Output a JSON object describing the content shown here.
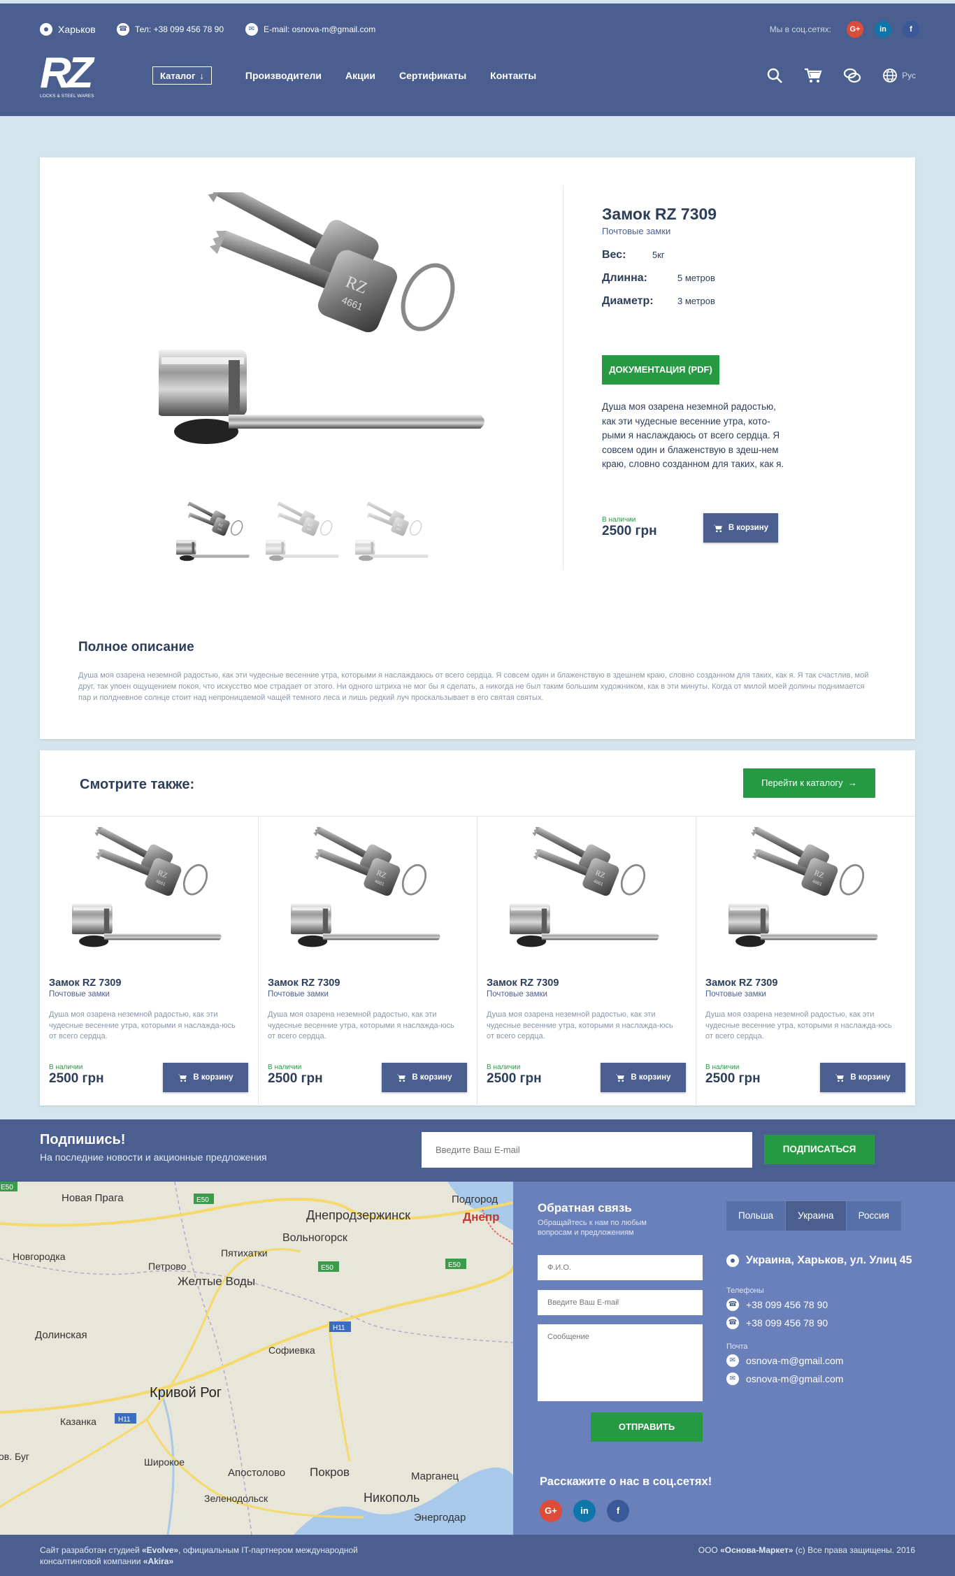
{
  "header": {
    "city": "Харьков",
    "phone": "Тел: +38 099 456 78 90",
    "email": "E-mail: osnova-m@gmail.com",
    "social_label": "Мы в соц.сетях:",
    "social": [
      {
        "icon": "google-plus-icon",
        "label": "G+",
        "color": "#dd4b39"
      },
      {
        "icon": "linkedin-icon",
        "label": "in",
        "color": "#0e76a8"
      },
      {
        "icon": "facebook-icon",
        "label": "f",
        "color": "#3b5998"
      }
    ],
    "logo_text": "RZ",
    "logo_sub": "LOCKS & STEEL WARES",
    "catalog": "Каталог",
    "nav": [
      "Производители",
      "Акции",
      "Сертификаты",
      "Контакты"
    ],
    "lang": "Рус"
  },
  "product": {
    "title": "Замок RZ 7309",
    "category": "Почтовые замки",
    "specs": [
      {
        "key": "Вес:",
        "value": "5кг"
      },
      {
        "key": "Длинна:",
        "value": "5 метров"
      },
      {
        "key": "Диаметр:",
        "value": "3 метров"
      }
    ],
    "doc_button": "ДОКУМЕНТАЦИЯ (PDF)",
    "description": "Душа моя озарена неземной радостью, как эти чудесные весенние утра, кото-рыми я наслаждаюсь от всего сердца. Я совсем один и блаженствую в здеш-нем краю, словно созданном для таких, как я.",
    "stock": "В наличии",
    "price": "2500 грн",
    "cart_button": "В корзину",
    "full_title": "Полное описание",
    "full_text": "Душа моя озарена неземной радостью, как эти чудесные весенние утра, которыми я наслаждаюсь от всего сердца. Я совсем один и блаженствую в здешнем краю, словно созданном для таких, как я. Я так счастлив, мой друг, так упоен ощущением покоя, что искусство мое страдает от этого. Ни одного штриха не мог бы я сделать, а никогда не был таким большим художником, как в эти минуты. Когда от милой моей долины поднимается пар и полдневное солнце стоит над непроницаемой чащей темного леса и лишь редкий луч проскальзывает в его святая святых."
  },
  "see_also": {
    "title": "Смотрите также:",
    "catalog_button": "Перейти к каталогу",
    "items": [
      {
        "name": "Замок RZ 7309",
        "category": "Почтовые замки",
        "desc": "Душа моя озарена неземной радостью, как эти чудесные весенние утра, которыми я наслажда-юсь от всего сердца.",
        "stock": "В наличии",
        "price": "2500 грн",
        "cart": "В корзину"
      },
      {
        "name": "Замок RZ 7309",
        "category": "Почтовые замки",
        "desc": "Душа моя озарена неземной радостью, как эти чудесные весенние утра, которыми я наслажда-юсь от всего сердца.",
        "stock": "В наличии",
        "price": "2500 грн",
        "cart": "В корзину"
      },
      {
        "name": "Замок RZ 7309",
        "category": "Почтовые замки",
        "desc": "Душа моя озарена неземной радостью, как эти чудесные весенние утра, которыми я наслажда-юсь от всего сердца.",
        "stock": "В наличии",
        "price": "2500 грн",
        "cart": "В корзину"
      },
      {
        "name": "Замок RZ 7309",
        "category": "Почтовые замки",
        "desc": "Душа моя озарена неземной радостью, как эти чудесные весенние утра, которыми я наслажда-юсь от всего сердца.",
        "stock": "В наличии",
        "price": "2500 грн",
        "cart": "В корзину"
      }
    ]
  },
  "subscribe": {
    "title": "Подпишись!",
    "text": "На последние новости и акционные предложения",
    "placeholder": "Введите Ваш E-mail",
    "button": "ПОДПИСАТЬСЯ"
  },
  "map": {
    "cities": [
      "Новая Прага",
      "Подгород",
      "Днепродзержинск",
      "Днепр",
      "Вольногорск",
      "Пятихатки",
      "Новгородка",
      "Петрово",
      "Желтые Воды",
      "Долинская",
      "Софиевка",
      "Кривой Рог",
      "Казанка",
      "Широкое",
      "Апостолово",
      "Покров",
      "Марганец",
      "Никополь",
      "Зеленодольск",
      "Энергодар",
      "ов. Буг"
    ],
    "roads": [
      "E50",
      "E50",
      "E50",
      "E50",
      "H11",
      "H11"
    ]
  },
  "feedback": {
    "title": "Обратная связь",
    "subtitle": "Обращайтесь к нам по любым вопросам и предложениям",
    "name_placeholder": "Ф.И.О.",
    "email_placeholder": "Введите Ваш E-mail",
    "message_placeholder": "Сообщение",
    "send_button": "ОТПРАВИТЬ",
    "tell_title": "Расскажите о нас в соц.сетях!"
  },
  "contacts": {
    "tabs": [
      "Польша",
      "Украина",
      "Россия"
    ],
    "address": "Украина, Харьков, ул. Улиц 45",
    "phones_label": "Телефоны",
    "phones": [
      "+38 099 456 78 90",
      "+38 099 456 78 90"
    ],
    "mail_label": "Почта",
    "emails": [
      "osnova-m@gmail.com",
      "osnova-m@gmail.com"
    ]
  },
  "footer": {
    "left_prefix": "Сайт разработан студией ",
    "studio": "«Evolve»",
    "left_middle": ", официальным IT-партнером международной консалтинговой компании ",
    "company": "«Akira»",
    "right_prefix": "ООО ",
    "right_company": "«Основа-Маркет»",
    "right_suffix": " (c) Все права защищены. 2016"
  },
  "colors": {
    "brand": "#4a5f8f",
    "green": "#259a42",
    "panel": "#6a80bb",
    "background": "#d5e5ee"
  }
}
